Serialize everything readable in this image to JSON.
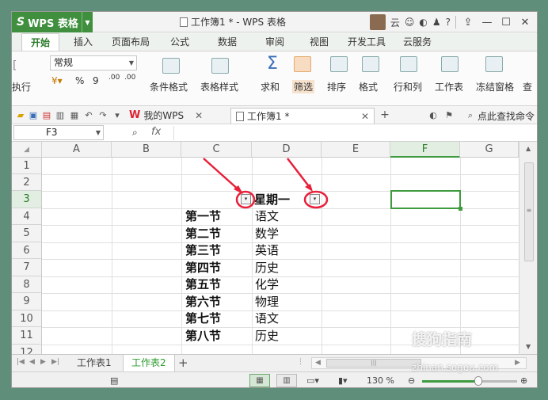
{
  "app": {
    "name": "WPS 表格",
    "logo_letter": "S",
    "window_title": "工作簿1 * - WPS 表格",
    "user_label": "云",
    "help_label": "?",
    "window_buttons": [
      "—",
      "☐",
      "✕"
    ]
  },
  "ribbon_tabs": [
    "开始",
    "插入",
    "页面布局",
    "公式",
    "数据",
    "审阅",
    "视图",
    "开发工具",
    "云服务"
  ],
  "ribbon": {
    "left_partial": "执行",
    "number_format": "常规",
    "percent": "%",
    "thousands": "9",
    "dec_inc": ".00",
    "dec_dec": ".00",
    "commands": [
      "条件格式",
      "表格样式",
      "求和",
      "筛选",
      "排序",
      "格式",
      "行和列",
      "工作表",
      "冻结窗格",
      "查"
    ]
  },
  "quickbar": {
    "doc_tabs": [
      "我的WPS",
      "工作簿1 *"
    ],
    "search_label": "点此查找命令"
  },
  "formula_bar": {
    "name_box": "F3",
    "fx": "fx"
  },
  "grid": {
    "columns": [
      "A",
      "B",
      "C",
      "D",
      "E",
      "F",
      "G"
    ],
    "selected_column": "F",
    "rows": [
      "1",
      "2",
      "3",
      "4",
      "5",
      "6",
      "7",
      "8",
      "9",
      "10",
      "11",
      "12"
    ],
    "header_D3": "星期一",
    "col_C": [
      "第一节",
      "第二节",
      "第三节",
      "第四节",
      "第五节",
      "第六节",
      "第七节",
      "第八节"
    ],
    "col_D": [
      "语文",
      "数学",
      "英语",
      "历史",
      "化学",
      "物理",
      "语文",
      "历史"
    ],
    "filter_arrow": "▾"
  },
  "sheets": [
    "工作表1",
    "工作表2"
  ],
  "active_sheet": "工作表2",
  "status": {
    "zoom": "130 %"
  },
  "watermark": {
    "text": "搜狗指南",
    "url": "zhinan.sogou.com"
  },
  "colors": {
    "accent": "#3f9b3f",
    "annotation": "#e8203a"
  }
}
